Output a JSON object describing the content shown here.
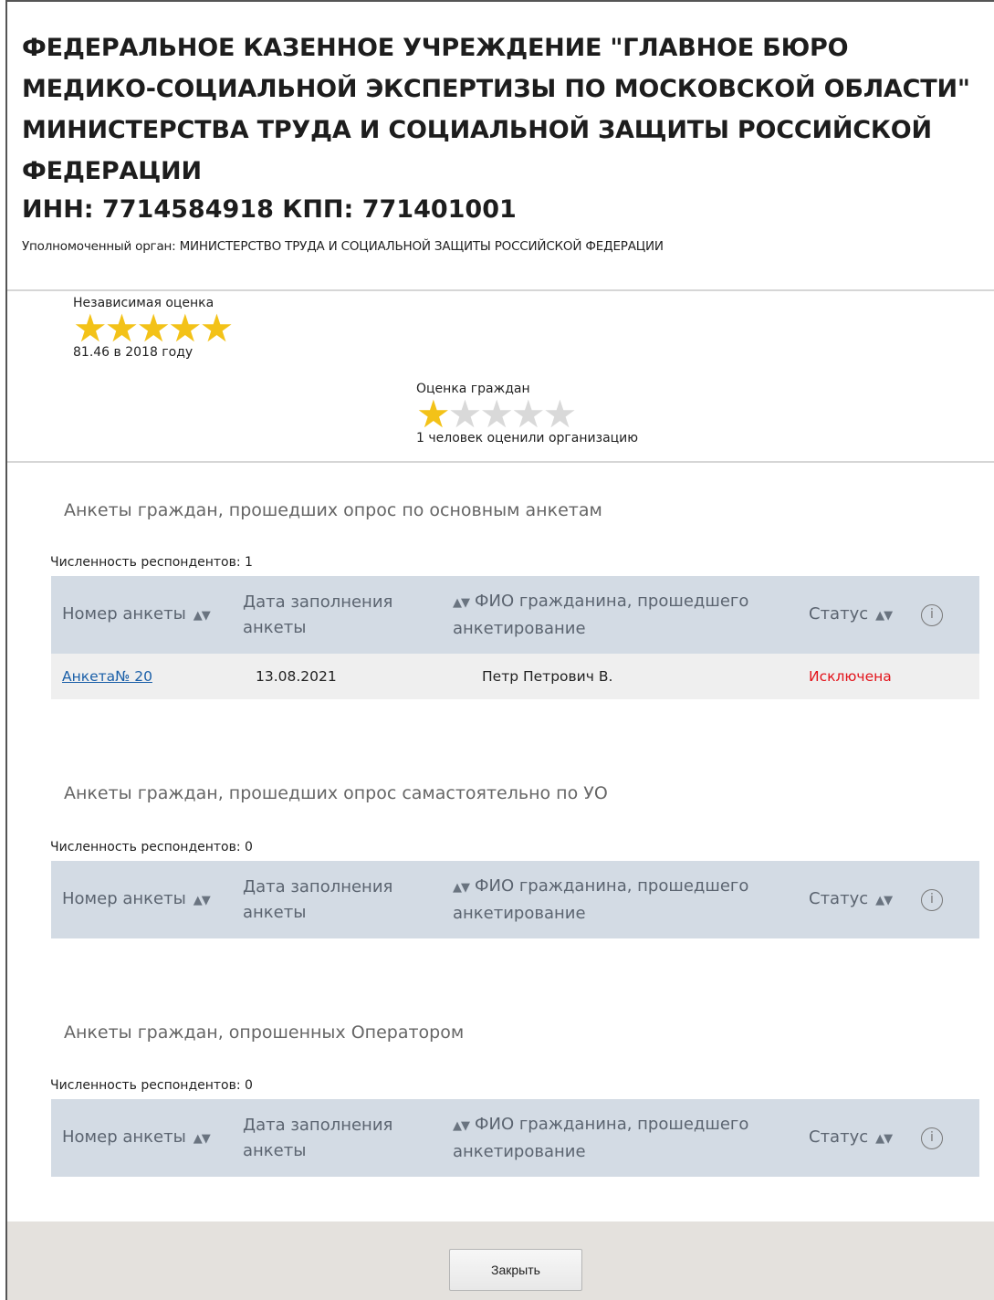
{
  "org": {
    "title": "ФЕДЕРАЛЬНОЕ КАЗЕННОЕ УЧРЕЖДЕНИЕ \"ГЛАВНОЕ БЮРО МЕДИКО-СОЦИАЛЬНОЙ ЭКСПЕРТИЗЫ ПО МОСКОВСКОЙ ОБЛАСТИ\" МИНИСТЕРСТВА ТРУДА И СОЦИАЛЬНОЙ ЗАЩИТЫ РОССИЙСКОЙ ФЕДЕРАЦИИ",
    "inn_kpp": "ИНН: 7714584918 КПП: 771401001",
    "authority": "Уполномоченный орган: МИНИСТЕРСТВО ТРУДА И СОЦИАЛЬНОЙ ЗАЩИТЫ РОССИЙСКОЙ ФЕДЕРАЦИИ"
  },
  "ratings": {
    "independent": {
      "label": "Независимая оценка",
      "stars_filled": 5,
      "stars_total": 5,
      "caption": "81.46 в 2018 году"
    },
    "citizens": {
      "label": "Оценка граждан",
      "stars_filled": 1,
      "stars_total": 5,
      "caption": "1 человек оценили организацию"
    },
    "star_color": "#f3c218"
  },
  "columns": {
    "number": "Номер анкеты",
    "date": "Дата заполнения анкеты",
    "fio": "ФИО гражданина, прошедшего анкетирование",
    "status": "Статус"
  },
  "sections": [
    {
      "title": "Анкеты граждан, прошедших опрос по основным анкетам",
      "count": "Численность респондентов: 1",
      "rows": [
        {
          "number": "Анкета№ 20",
          "date": "13.08.2021",
          "fio": "Петр Петрович В.",
          "status": "Исключена"
        }
      ]
    },
    {
      "title": "Анкеты граждан, прошедших опрос самастоятельно по УО",
      "count": "Численность респондентов: 0",
      "rows": []
    },
    {
      "title": "Анкеты граждан, опрошенных Оператором",
      "count": "Численность респондентов: 0",
      "rows": []
    }
  ],
  "status_color": "#e3141b",
  "footer": {
    "close_label": "Закрыть"
  }
}
